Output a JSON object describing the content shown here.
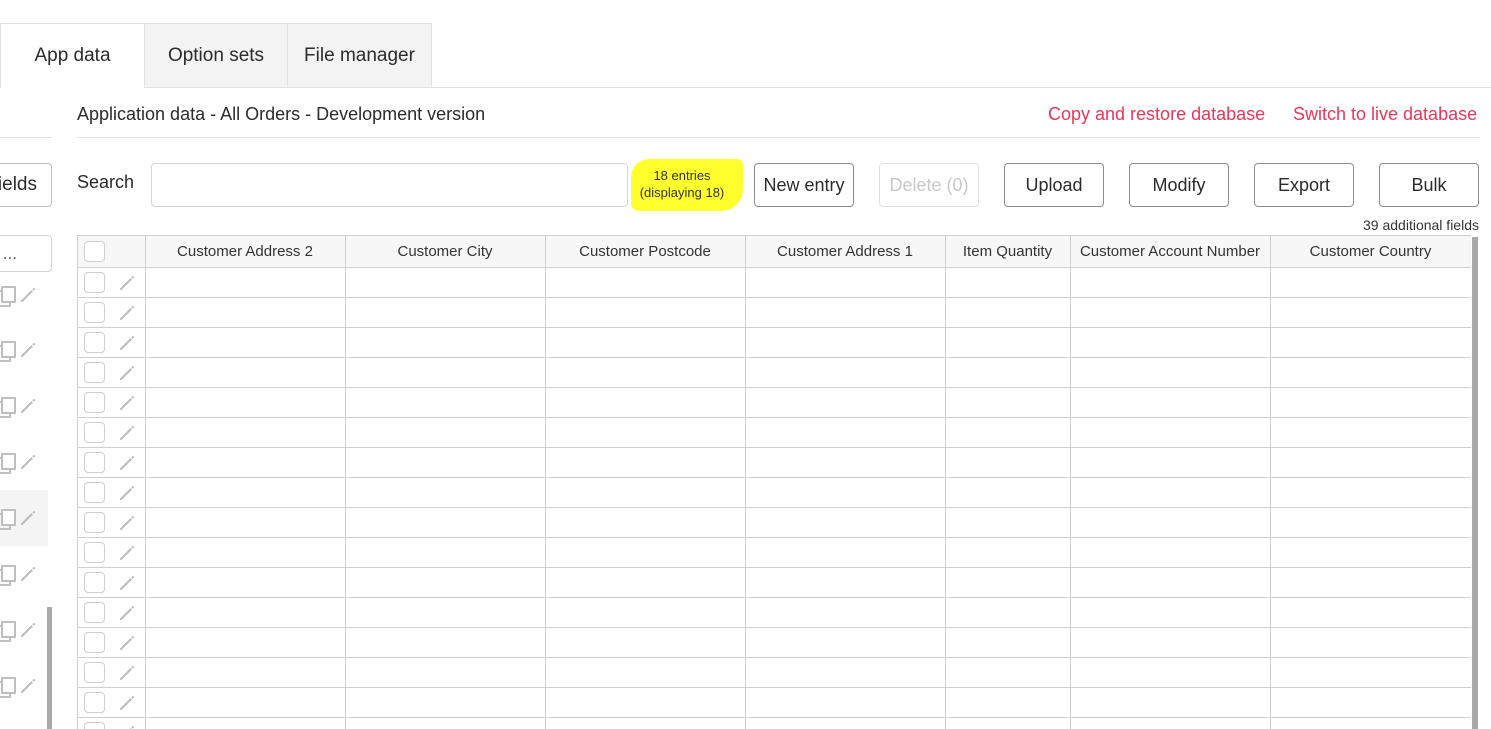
{
  "tabs": [
    {
      "label": "App data"
    },
    {
      "label": "Option sets"
    },
    {
      "label": "File manager"
    }
  ],
  "sidebar": {
    "fields_button": "ields",
    "type_select": "..."
  },
  "header": {
    "title": "Application data - All Orders - Development version",
    "copy_restore_link": "Copy and restore database",
    "switch_live_link": "Switch to live database"
  },
  "toolbar": {
    "search_label": "Search",
    "search_value": "",
    "entries_line1": "18 entries",
    "entries_line2": "(displaying 18)",
    "new_entry": "New entry",
    "delete": "Delete (0)",
    "upload": "Upload",
    "modify": "Modify",
    "export": "Export",
    "bulk": "Bulk",
    "additional_fields": "39 additional fields"
  },
  "table": {
    "columns": [
      "Customer Address 2",
      "Customer City",
      "Customer Postcode",
      "Customer Address 1",
      "Item Quantity",
      "Customer Account Number",
      "Customer Country"
    ]
  },
  "colors": {
    "link": "#e8375a",
    "highlight": "#ffff2e",
    "border": "#cfcfcf"
  },
  "icons": {
    "row_edit": "pencil-icon",
    "row_copy": "copy-icon"
  }
}
